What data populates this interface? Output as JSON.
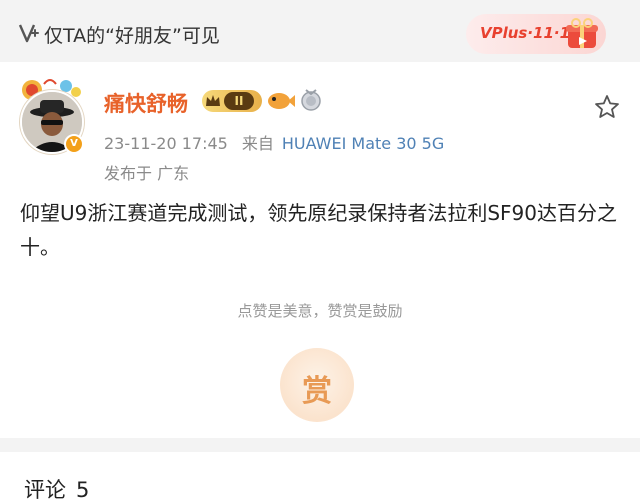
{
  "visibility": {
    "icon": "visibility-v-icon",
    "text": "仅TA的“好朋友”可见"
  },
  "promo": {
    "label": "VPlus·11·11",
    "icon": "gift-box-icon",
    "color": "#e8412f"
  },
  "post": {
    "author": {
      "name": "痛快舒畅",
      "name_color": "#e8622a",
      "level_badge": "II",
      "verified_icon": "v-verified-icon"
    },
    "timestamp": "23-11-20 17:45",
    "source_label": "来自",
    "device": "HUAWEI Mate 30 5G",
    "device_color": "#4f81b5",
    "location": "发布于 广东",
    "text": "仰望U9浙江赛道完成测试，领先原纪录保持者法拉利SF90达百分之十。",
    "favorite_icon": "star-outline-icon"
  },
  "reward": {
    "hint": "点赞是美意，赞赏是鼓励",
    "button_label": "赏"
  },
  "comments": {
    "label": "评论",
    "count": "5"
  }
}
